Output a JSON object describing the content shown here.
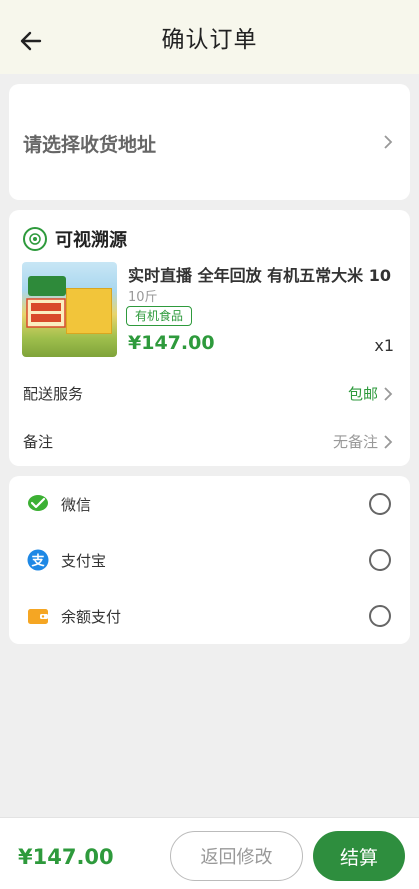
{
  "header": {
    "title": "确认订单"
  },
  "address": {
    "placeholder_text": "请选择收货地址"
  },
  "shop": {
    "name": "可视溯源"
  },
  "product": {
    "title": "实时直播 全年回放 有机五常大米 10",
    "spec": "10斤",
    "badge": "有机食品",
    "price": "¥147.00",
    "quantity": "x1"
  },
  "delivery": {
    "label": "配送服务",
    "value": "包邮"
  },
  "remark": {
    "label": "备注",
    "value": "无备注"
  },
  "payment": {
    "options": [
      {
        "label": "微信",
        "icon": "wechat-icon",
        "color": "#3cb034"
      },
      {
        "label": "支付宝",
        "icon": "alipay-icon",
        "color": "#1e88e5"
      },
      {
        "label": "余额支付",
        "icon": "wallet-icon",
        "color": "#f5a623"
      }
    ]
  },
  "footer": {
    "total": "¥147.00",
    "back_label": "返回修改",
    "pay_label": "结算"
  },
  "colors": {
    "accent": "#2e9a3c",
    "header_bg": "#f7f7ec"
  }
}
